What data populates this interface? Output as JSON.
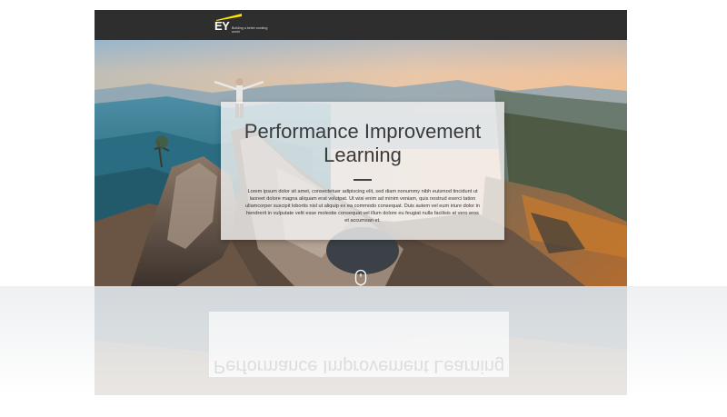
{
  "brand": {
    "logo_text": "EY",
    "tagline": "Building a better working world",
    "accent_color": "#ffe600",
    "topbar_color": "#2e2e2e"
  },
  "hero": {
    "title": "Performance Improvement Learning",
    "body": "Lorem ipsum dolor sit amet, consectetuer adipiscing elit, sed diam nonummy nibh euismod tincidunt ut laoreet dolore magna aliquam erat volutpat. Ut wisi enim ad minim veniam, quis nostrud exerci tation ullamcorper suscipit lobortis nisl ut aliquip ex ea commodo consequat. Duis autem vel eum iriure dolor in hendrerit in vulputate velit esse molestie consequat vel illum dolore eu feugiat nulla facilisis at vero eros et accumsan et.",
    "scroll_icon": "mouse-scroll-icon"
  }
}
